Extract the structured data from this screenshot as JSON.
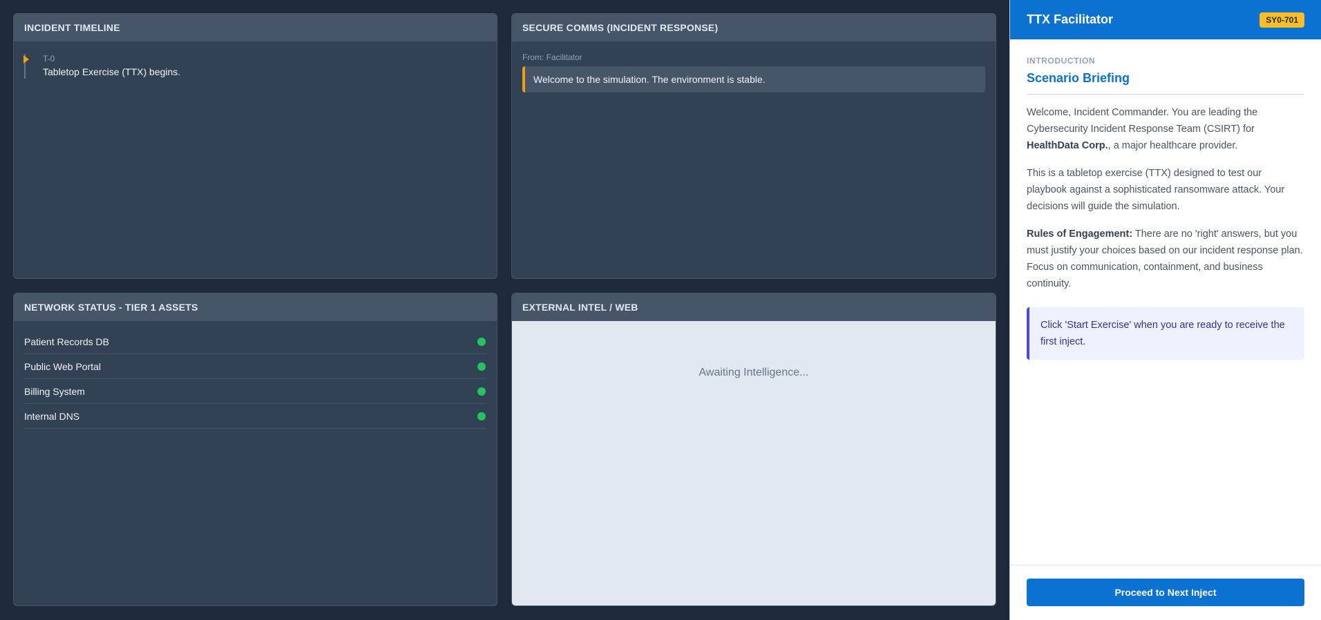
{
  "timeline": {
    "header": "INCIDENT TIMELINE",
    "entries": [
      {
        "time": "T-0",
        "text": "Tabletop Exercise (TTX) begins."
      }
    ]
  },
  "comms": {
    "header": "SECURE COMMS (INCIDENT RESPONSE)",
    "messages": [
      {
        "from": "From: Facilitator",
        "text": "Welcome to the simulation. The environment is stable."
      }
    ]
  },
  "network": {
    "header": "NETWORK STATUS - TIER 1 ASSETS",
    "assets": [
      {
        "name": "Patient Records DB",
        "status": "online"
      },
      {
        "name": "Public Web Portal",
        "status": "online"
      },
      {
        "name": "Billing System",
        "status": "online"
      },
      {
        "name": "Internal DNS",
        "status": "online"
      }
    ],
    "status_color": "#22c55e"
  },
  "intel": {
    "header": "EXTERNAL INTEL / WEB",
    "placeholder": "Awaiting Intelligence..."
  },
  "sidebar": {
    "title": "TTX Facilitator",
    "badge": "SY0-701",
    "section_label": "INTRODUCTION",
    "section_title": "Scenario Briefing",
    "p1_a": "Welcome, Incident Commander. You are leading the Cybersecurity Incident Response Team (CSIRT) for ",
    "p1_bold": "HealthData Corp.",
    "p1_b": ", a major healthcare provider.",
    "p2": "This is a tabletop exercise (TTX) designed to test our playbook against a sophisticated ransomware attack. Your decisions will guide the simulation.",
    "p3_bold": "Rules of Engagement:",
    "p3": " There are no 'right' answers, but you must justify your choices based on our incident response plan. Focus on communication, containment, and business continuity.",
    "callout": "Click 'Start Exercise' when you are ready to receive the first inject.",
    "button_label": "Proceed to Next Inject"
  },
  "colors": {
    "accent": "#0b72d2",
    "warning": "#f59e0b",
    "badge": "#fbbf24",
    "ok": "#22c55e"
  }
}
